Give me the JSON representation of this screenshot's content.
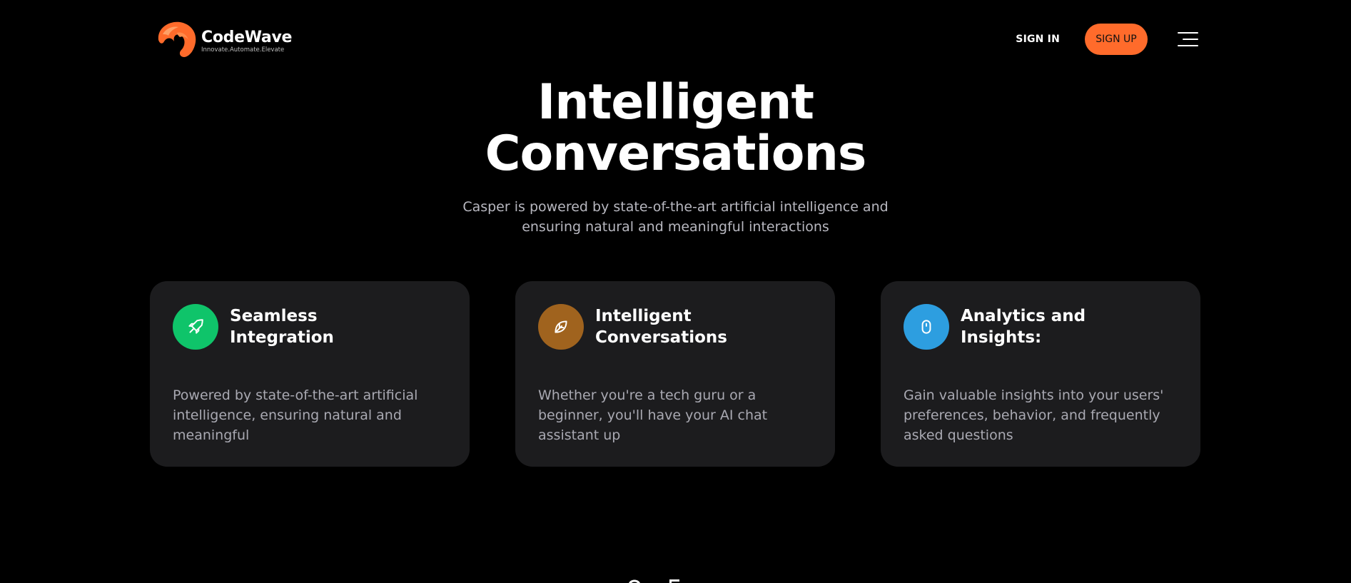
{
  "header": {
    "brand_name": "CodeWave",
    "brand_tagline": "Innovate.Automate.Elevate",
    "signin_label": "SIGN IN",
    "signup_label": "SIGN UP",
    "accent_color": "#ff6b2b"
  },
  "hero": {
    "title_line1": "Intelligent",
    "title_line2": "Conversations",
    "subtitle_line1": "Casper is powered by state-of-the-art artificial intelligence and",
    "subtitle_line2": "ensuring natural and meaningful interactions"
  },
  "features": [
    {
      "icon": "rocket-icon",
      "icon_color": "#0fc46a",
      "title_line1": "Seamless",
      "title_line2": "Integration",
      "description": "Powered by state-of-the-art artificial intelligence, ensuring natural and meaningful"
    },
    {
      "icon": "leaf-icon",
      "icon_color": "#a0631e",
      "title_line1": "Intelligent",
      "title_line2": "Conversations",
      "description": "Whether you're a tech guru or a beginner, you'll have your AI chat assistant up"
    },
    {
      "icon": "mouse-icon",
      "icon_color": "#2d9ee0",
      "title_line1": "Analytics and",
      "title_line2": "Insights:",
      "description": "Gain valuable insights into your users' preferences, behavior, and frequently asked questions"
    }
  ]
}
